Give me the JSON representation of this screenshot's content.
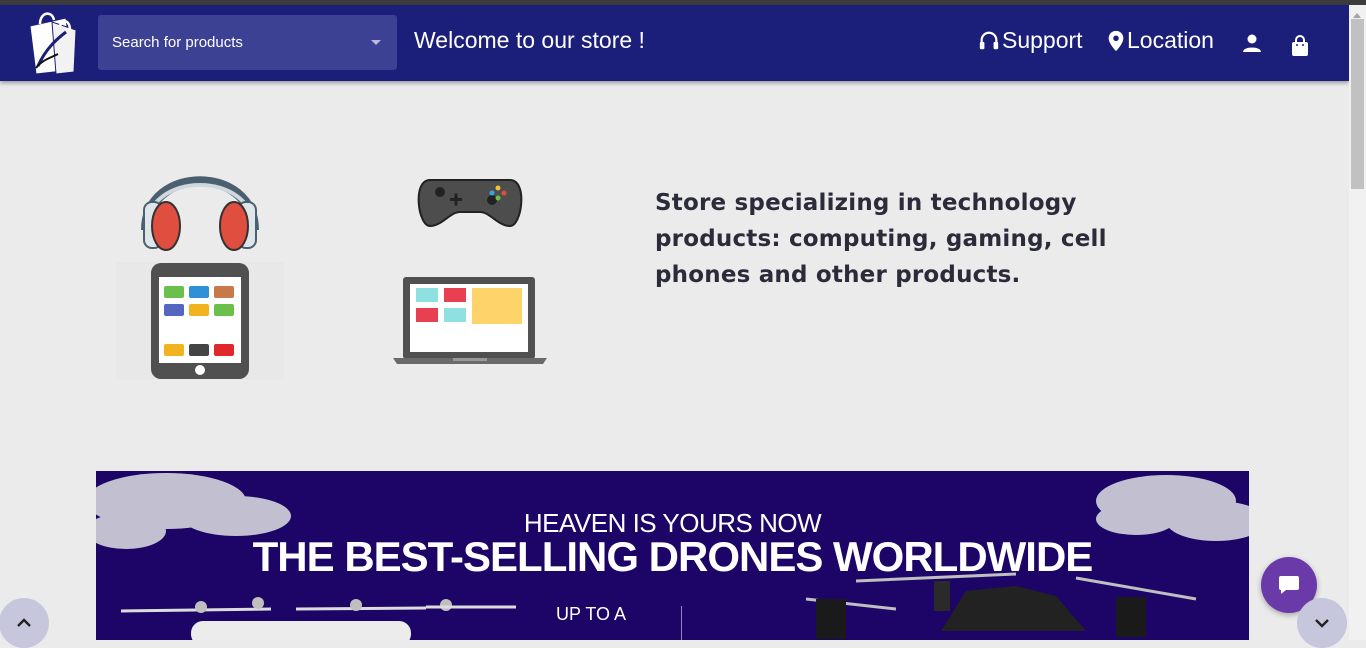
{
  "header": {
    "search_label": "Search for products",
    "welcome": "Welcome to our store !",
    "nav": [
      {
        "label": "Support",
        "icon": "headphones-icon"
      },
      {
        "label": "Location",
        "icon": "map-pin-icon"
      }
    ],
    "account_icon": "user-icon",
    "cart_icon": "shopping-bag-icon"
  },
  "hero": {
    "description": "Store specializing in technology products: computing, gaming, cell phones and other products.",
    "images": [
      "headphones",
      "game-controller",
      "smartphone",
      "laptop"
    ]
  },
  "banner": {
    "tagline": "HEAVEN IS YOURS NOW",
    "title": "THE BEST-SELLING DRONES WORLDWIDE",
    "upto": "UP TO A"
  },
  "colors": {
    "navbar": "#1b1f7a",
    "search": "#3d4193",
    "page_bg": "#ebebeb",
    "banner_bg": "#1c0566",
    "chat_button": "#6a3ba8"
  }
}
